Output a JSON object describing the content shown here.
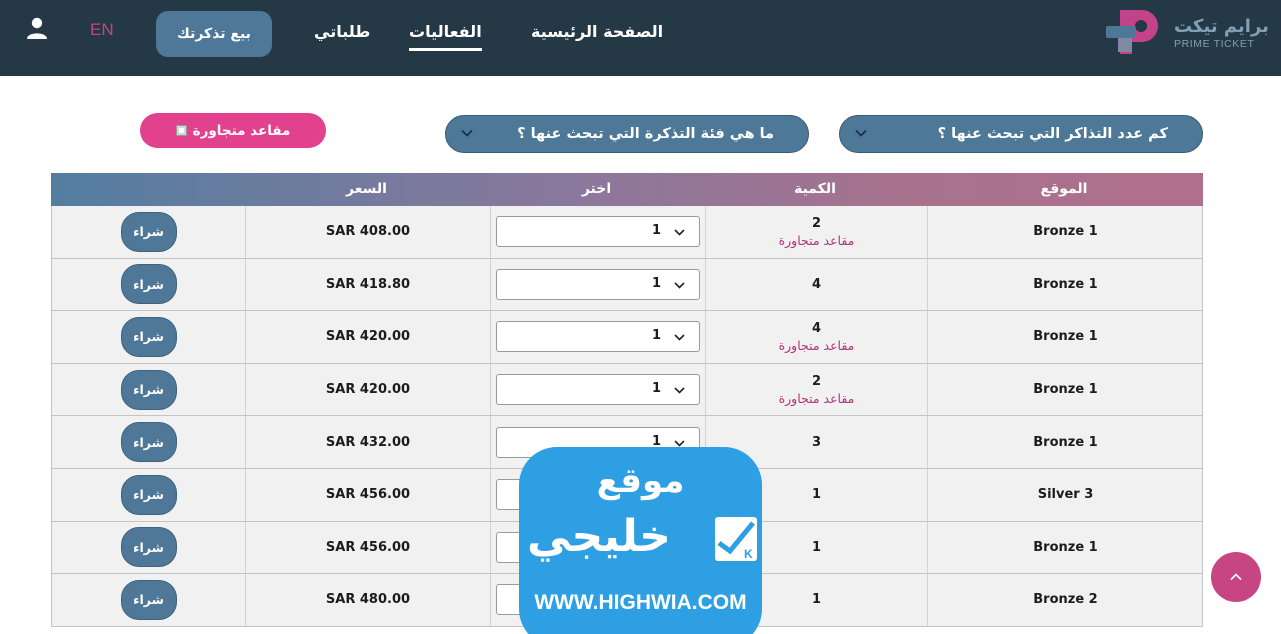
{
  "header": {
    "lang": "EN",
    "sell_button": "بيع تذكرتك",
    "nav": [
      "طلباتي",
      "الفعاليات",
      "الصفحة الرئيسية"
    ],
    "logo_ar": "برايم تيكت",
    "logo_en": "PRIME TICKET"
  },
  "filters": {
    "adjacent_seats": "مقاعد متجاورة",
    "category_select": "ما هي فئة التذكرة التي تبحث عنها ؟",
    "count_select": "كم عدد التذاكر التي تبحث عنها ؟"
  },
  "table": {
    "headers": {
      "location": "الموقع",
      "quantity": "الكمية",
      "select": "اختر",
      "price": "السعر"
    },
    "rows": [
      {
        "location": "Bronze 1",
        "qty": "2",
        "adjacent": "مقاعد متجاورة",
        "select": "1",
        "price": "SAR 408.00",
        "buy": "شراء"
      },
      {
        "location": "Bronze 1",
        "qty": "4",
        "adjacent": "",
        "select": "1",
        "price": "SAR 418.80",
        "buy": "شراء"
      },
      {
        "location": "Bronze 1",
        "qty": "4",
        "adjacent": "مقاعد متجاورة",
        "select": "1",
        "price": "SAR 420.00",
        "buy": "شراء"
      },
      {
        "location": "Bronze 1",
        "qty": "2",
        "adjacent": "مقاعد متجاورة",
        "select": "1",
        "price": "SAR 420.00",
        "buy": "شراء"
      },
      {
        "location": "Bronze 1",
        "qty": "3",
        "adjacent": "",
        "select": "1",
        "price": "SAR 432.00",
        "buy": "شراء"
      },
      {
        "location": "Silver 3",
        "qty": "1",
        "adjacent": "",
        "select": "",
        "price": "SAR 456.00",
        "buy": "شراء"
      },
      {
        "location": "Bronze 1",
        "qty": "1",
        "adjacent": "",
        "select": "",
        "price": "SAR 456.00",
        "buy": "شراء"
      },
      {
        "location": "Bronze 2",
        "qty": "1",
        "adjacent": "",
        "select": "",
        "price": "SAR 480.00",
        "buy": "شراء"
      }
    ]
  },
  "watermark": {
    "top": "موقع",
    "main": "خليجي",
    "url": "WWW.HIGHWIA.COM"
  },
  "colors": {
    "header_bg": "#253846",
    "accent_blue": "#4f7898",
    "accent_pink": "#e2418d",
    "adjacent_text": "#b0357a"
  },
  "icons": {
    "user": "user-icon",
    "chevron": "chevron-down-icon",
    "scroll_top": "chevron-up-icon"
  }
}
